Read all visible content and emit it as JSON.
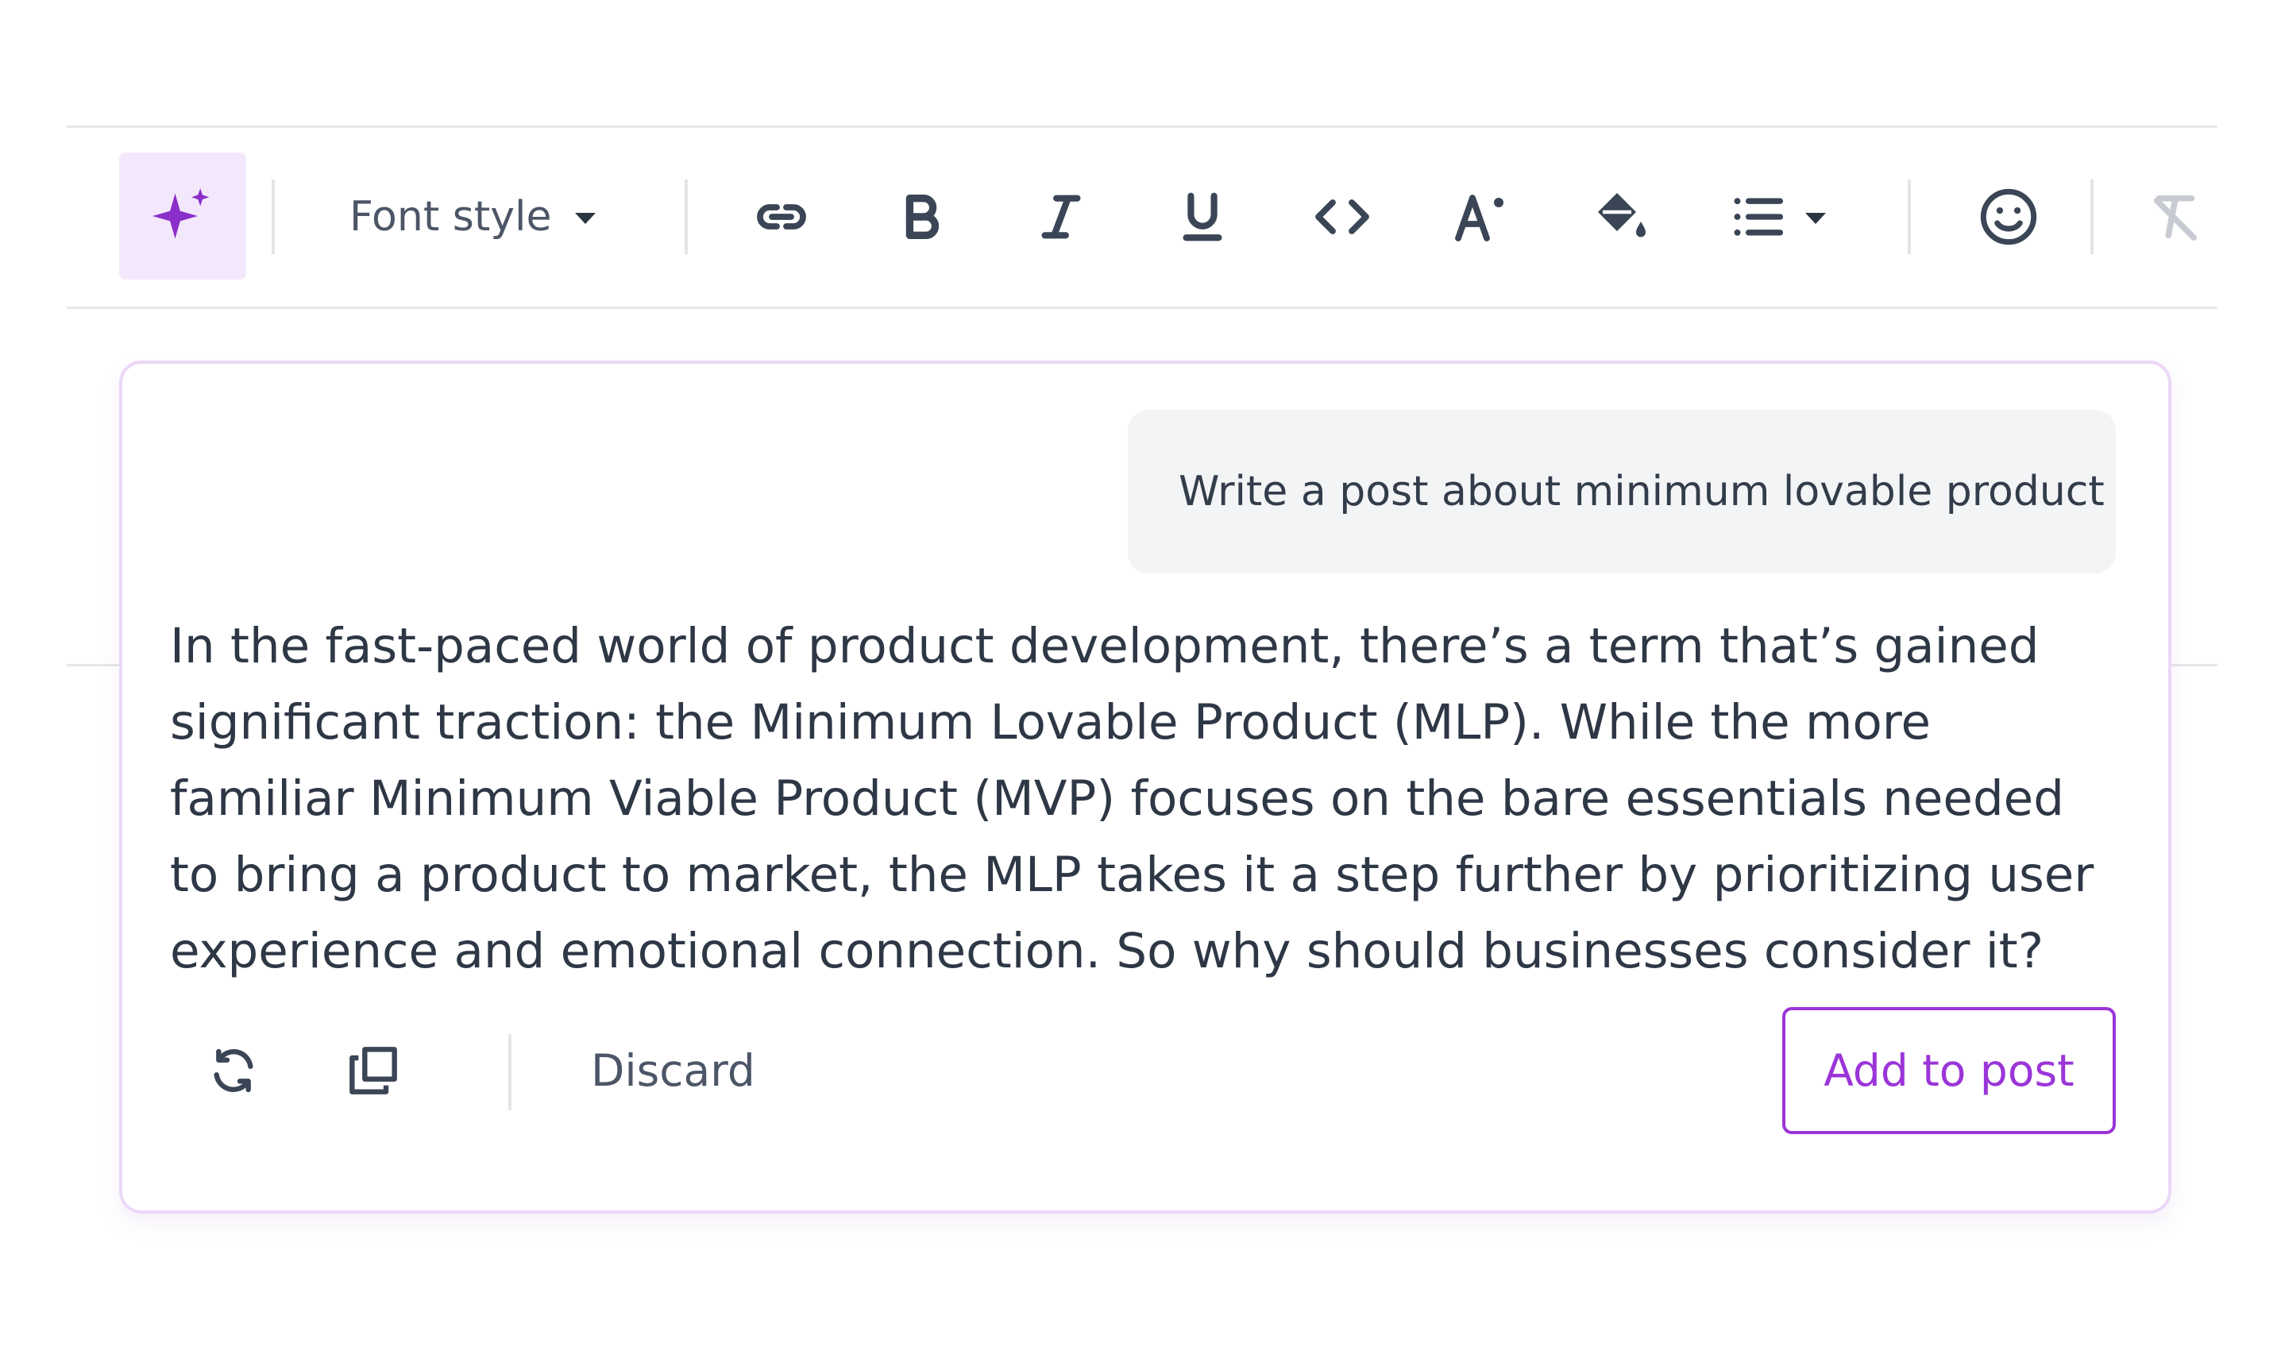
{
  "toolbar": {
    "ai_icon": "sparkle-icon",
    "font_style_label": "Font style",
    "icons": [
      "link-icon",
      "bold-icon",
      "italic-icon",
      "underline-icon",
      "code-icon",
      "text-size-icon",
      "fill-color-icon",
      "list-icon",
      "emoji-icon",
      "clear-format-icon"
    ]
  },
  "assistant": {
    "prompt": "Write a post about minimum lovable product",
    "response": "In the fast-paced world of product development, there’s a term that’s gained significant traction: the Minimum Lovable Product (MLP). While the more familiar Minimum Viable Product (MVP) focuses on the bare essentials needed to bring a product to market, the MLP takes it a step further by prioritizing user experience and emotional connection. So why should businesses consider it?",
    "discard_label": "Discard",
    "add_label": "Add to post"
  },
  "colors": {
    "accent": "#9b35d8",
    "accent_bg": "#f3e8fb",
    "icon": "#3a4556",
    "prompt_bg": "#f3f4f6"
  }
}
